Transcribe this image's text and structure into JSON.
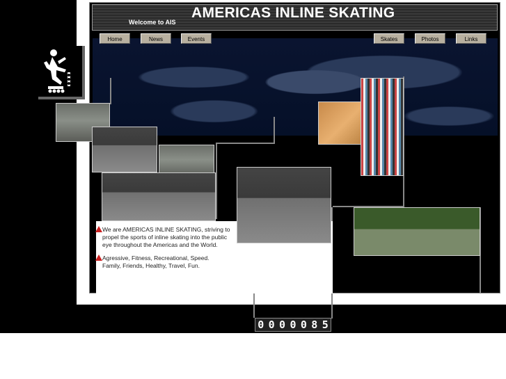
{
  "header": {
    "title": "AMERICAS INLINE SKATING",
    "welcome": "Welcome to AIS"
  },
  "nav": {
    "home": "Home",
    "news": "News",
    "events": "Events",
    "skates": "Skates",
    "photos": "Photos",
    "links": "Links"
  },
  "intro": {
    "paragraph1": "We are AMERICAS INLINE SKATING,  striving to propel the sports of inline skating into the public eye throughout the Americas and the World.",
    "paragraph2_line1": "Agressive, Fitness, Recreational, Speed.",
    "paragraph2_line2": "Family, Friends, Healthy, Travel, Fun."
  },
  "counter": {
    "digits": [
      "0",
      "0",
      "0",
      "0",
      "0",
      "8",
      "5"
    ]
  },
  "colors": {
    "background": "#000000",
    "panel": "#ffffff",
    "nav_button": "#b8b0a0",
    "bullet": "#cc2222"
  }
}
